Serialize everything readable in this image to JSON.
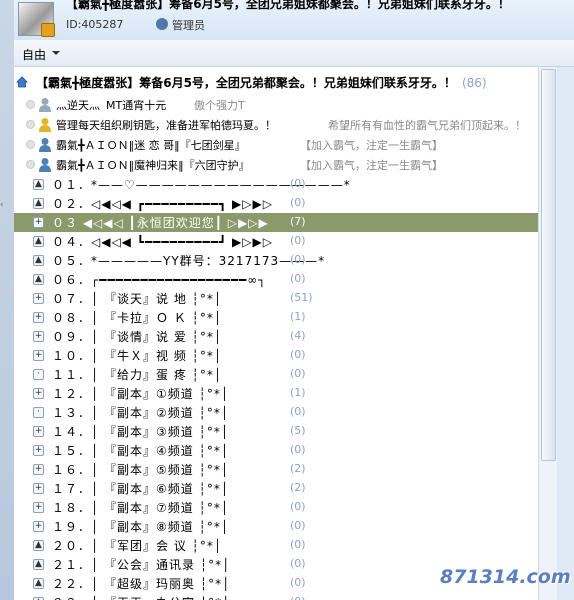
{
  "header": {
    "title": "【霸氣╋極度嚣张】筹备6月5号，全团兄弟姐妹都聚会。！兄弟姐妹们联系牙牙。！",
    "id": "ID:405287",
    "role": "管理员"
  },
  "toolbar": {
    "mode": "自由"
  },
  "thread": {
    "title": "【霸氣╋極度嚣张】筹备6月5号，全团兄弟都聚会。！兄弟姐妹们联系牙牙。！",
    "count": "(86)"
  },
  "users": [
    {
      "name": "灬逆天灬",
      "extra": "MT通宵十元",
      "badge": "傲个强力T",
      "icon": "user-icon"
    },
    {
      "name": "管理每天组织刷钥匙，准备进军帕德玛夏。！",
      "extra": "",
      "badge": "希望所有有血性的霸气兄弟们顶起来。！",
      "icon": "admin-icon"
    },
    {
      "name": "霸氣╋ＡＩＯＮ‖迷 恋 哥‖『七团剑星』",
      "extra": "",
      "badge": "【加入霸气，注定一生霸气】",
      "icon": "member-icon"
    },
    {
      "name": "霸氣╋ＡＩＯＮ‖魔神归来‖『六团守护』",
      "extra": "",
      "badge": "【加入霸气，注定一生霸气】",
      "icon": "member-icon"
    }
  ],
  "channels": [
    {
      "label": "０１．*——♡————————————————*",
      "count": "(0)",
      "sign": "▲"
    },
    {
      "label": "０２．◁◀◁◀ ┏━━━━━━━━━┓ ▶▷▶▷",
      "count": "(0)",
      "sign": "▲"
    },
    {
      "label": "０３ ◀◁◀◁ ┃永恒团欢迎您┃ ▷▶▷▶",
      "count": "(7)",
      "sign": "+"
    },
    {
      "label": "０４．◁◀◁◀ ┗━━━━━━━━━┛ ▶▷▶▷",
      "count": "(0)",
      "sign": "▲"
    },
    {
      "label": "０５．*—————YY群号：3217173———*",
      "count": "(0)",
      "sign": "▲"
    },
    {
      "label": "０６．┌━━━━━━━━━━━━━━━━━━∞┐",
      "count": "(0)",
      "sign": "▲"
    },
    {
      "label": "０７．│ 『谈天』说 地 ┆°*│",
      "count": "(51)",
      "sign": "+"
    },
    {
      "label": "０８．│ 『卡拉』Ｏ Ｋ ┆°*│",
      "count": "(1)",
      "sign": "+"
    },
    {
      "label": "０９．│ 『谈情』说 爱 ┆°*│",
      "count": "(4)",
      "sign": "+"
    },
    {
      "label": "１０．│ 『牛Ｘ』视 频 ┆°*│",
      "count": "(0)",
      "sign": "+"
    },
    {
      "label": "１１．│ 『给力』蛋 疼 ┆°*│",
      "count": "(0)",
      "sign": "·"
    },
    {
      "label": "１２．│ 『副本』①频道 ┆°*│",
      "count": "(1)",
      "sign": "+"
    },
    {
      "label": "１３．│ 『副本』②频道 ┆°*│",
      "count": "(0)",
      "sign": "·"
    },
    {
      "label": "１４．│ 『副本』③频道 ┆°*│",
      "count": "(5)",
      "sign": "+"
    },
    {
      "label": "１５．│ 『副本』④频道 ┆°*│",
      "count": "(0)",
      "sign": "+"
    },
    {
      "label": "１６．│ 『副本』⑤频道 ┆°*│",
      "count": "(2)",
      "sign": "+"
    },
    {
      "label": "１７．│ 『副本』⑥频道 ┆°*│",
      "count": "(2)",
      "sign": "+"
    },
    {
      "label": "１８．│ 『副本』⑦频道 ┆°*│",
      "count": "(0)",
      "sign": "+"
    },
    {
      "label": "１９．│ 『副本』⑧频道 ┆°*│",
      "count": "(0)",
      "sign": "+"
    },
    {
      "label": "２０．│ 『军团』会 议 ┆°*│",
      "count": "(0)",
      "sign": "▲"
    },
    {
      "label": "２１．│ 『公会』通讯录 ┆°*│",
      "count": "(0)",
      "sign": "▲"
    },
    {
      "label": "２２．│ 『超级』玛丽奥 ┆°*│",
      "count": "(0)",
      "sign": "▲"
    },
    {
      "label": "２３．│ 『天王』办公室 ┆°*│",
      "count": "(0)",
      "sign": "▲"
    }
  ],
  "watermark": "871314.com",
  "colors": {
    "accent": "#8fa0c8",
    "selected": "#8a9a6a",
    "gold": "#e5a11b"
  }
}
